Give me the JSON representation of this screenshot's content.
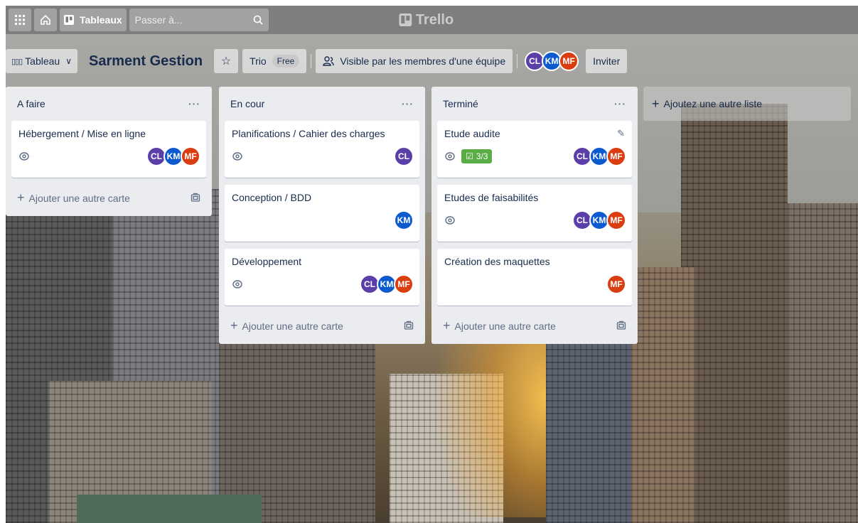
{
  "topbar": {
    "apps_icon": "grid-icon",
    "home_icon": "home-icon",
    "boards_label": "Tableaux",
    "search_placeholder": "Passer à...",
    "logo_text": "Trello"
  },
  "board": {
    "view_label": "Tableau",
    "title": "Sarment Gestion",
    "team_label": "Trio",
    "plan_badge": "Free",
    "visibility_label": "Visible par les membres d'une équipe",
    "members": [
      "CL",
      "KM",
      "MF"
    ],
    "invite_label": "Inviter"
  },
  "lists": [
    {
      "title": "A faire",
      "cards": [
        {
          "title": "Hébergement / Mise en ligne",
          "watch": true,
          "members": [
            "CL",
            "KM",
            "MF"
          ]
        }
      ],
      "add_card_label": "Ajouter une autre carte"
    },
    {
      "title": "En cour",
      "cards": [
        {
          "title": "Planifications / Cahier des charges",
          "watch": true,
          "members": [
            "CL"
          ]
        },
        {
          "title": "Conception / BDD",
          "watch": false,
          "members": [
            "KM"
          ]
        },
        {
          "title": "Développement",
          "watch": true,
          "members": [
            "CL",
            "KM",
            "MF"
          ]
        }
      ],
      "add_card_label": "Ajouter une autre carte"
    },
    {
      "title": "Terminé",
      "cards": [
        {
          "title": "Etude audite",
          "watch": true,
          "checklist": "3/3",
          "members": [
            "CL",
            "KM",
            "MF"
          ]
        },
        {
          "title": "Etudes de faisabilités",
          "watch": true,
          "members": [
            "CL",
            "KM",
            "MF"
          ]
        },
        {
          "title": "Création des maquettes",
          "watch": false,
          "members": [
            "MF"
          ]
        }
      ],
      "add_card_label": "Ajouter une autre carte"
    }
  ],
  "add_list_label": "Ajoutez une autre liste",
  "colors": {
    "cl": "#5b3fa8",
    "km": "#0b5ad0",
    "mf": "#d93d10",
    "checklist_done": "#5aac44"
  }
}
